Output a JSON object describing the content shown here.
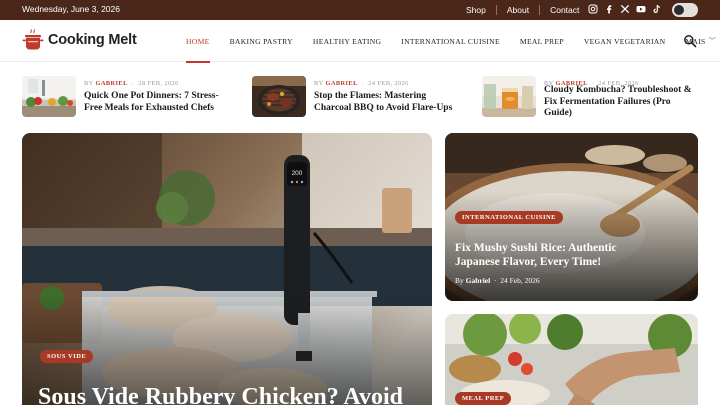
{
  "topbar": {
    "date": "Wednesday, June 3, 2026",
    "links": [
      "Shop",
      "About",
      "Contact"
    ],
    "socials": [
      "instagram-icon",
      "facebook-icon",
      "x-icon",
      "youtube-icon",
      "tiktok-icon"
    ]
  },
  "header": {
    "logo_text": "Cooking Melt",
    "nav": [
      {
        "label": "HOME",
        "active": true
      },
      {
        "label": "BAKING PASTRY"
      },
      {
        "label": "HEALTHY EATING"
      },
      {
        "label": "INTERNATIONAL CUISINE"
      },
      {
        "label": "MEAL PREP"
      },
      {
        "label": "VEGAN VEGETARIAN"
      },
      {
        "label": "MAIS"
      }
    ]
  },
  "mini_posts": [
    {
      "by": "BY",
      "author": "GABRIEL",
      "date": "28 FEB, 2026",
      "title": "Quick One Pot Dinners: 7 Stress-Free Meals for Exhausted Chefs"
    },
    {
      "by": "BY",
      "author": "GABRIEL",
      "date": "24 FEB, 2026",
      "title": "Stop the Flames: Mastering Charcoal BBQ to Avoid Flare-Ups"
    },
    {
      "by": "BY",
      "author": "GABRIEL",
      "date": "24 FEB, 2026",
      "title": "Cloudy Kombucha? Troubleshoot & Fix Fermentation Failures (Pro Guide)"
    }
  ],
  "featured": {
    "category": "SOUS VIDE",
    "title": "Sous Vide Rubbery Chicken? Avoid"
  },
  "side_cards": [
    {
      "category": "INTERNATIONAL CUISINE",
      "title": "Fix Mushy Sushi Rice: Authentic Japanese Flavor, Every Time!",
      "by": "By",
      "author": "Gabriel",
      "date": "24 Feb, 2026"
    },
    {
      "category": "MEAL PREP"
    }
  ],
  "device_display": "200",
  "colors": {
    "accent": "#c0392b",
    "topbar": "#4b271a",
    "badge": "#a83a25"
  }
}
